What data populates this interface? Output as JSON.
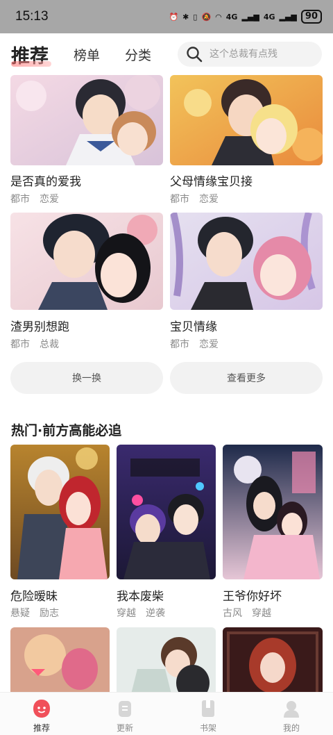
{
  "status": {
    "time": "15:13",
    "signal1": "4G",
    "signal2": "4G",
    "battery": "90"
  },
  "nav": {
    "tabs": [
      {
        "label": "推荐",
        "active": true
      },
      {
        "label": "榜单",
        "active": false
      },
      {
        "label": "分类",
        "active": false
      }
    ],
    "search_placeholder": "这个总裁有点残"
  },
  "grid": [
    {
      "title": "是否真的爱我",
      "tags": [
        "都市",
        "恋爱"
      ]
    },
    {
      "title": "父母情缘宝贝接",
      "tags": [
        "都市",
        "恋爱"
      ]
    },
    {
      "title": "渣男别想跑",
      "tags": [
        "都市",
        "总裁"
      ]
    },
    {
      "title": "宝贝情缘",
      "tags": [
        "都市",
        "恋爱"
      ]
    }
  ],
  "buttons": {
    "refresh": "换一换",
    "more": "查看更多"
  },
  "hot": {
    "title": "热门·前方高能必追",
    "items": [
      {
        "title": "危险暧昧",
        "tags": [
          "悬疑",
          "励志"
        ]
      },
      {
        "title": "我本废柴",
        "tags": [
          "穿越",
          "逆袭"
        ]
      },
      {
        "title": "王爷你好坏",
        "tags": [
          "古风",
          "穿越"
        ]
      }
    ]
  },
  "bottom_nav": [
    {
      "label": "推荐",
      "icon": "recommend-icon",
      "active": true
    },
    {
      "label": "更新",
      "icon": "update-icon",
      "active": false
    },
    {
      "label": "书架",
      "icon": "bookshelf-icon",
      "active": false
    },
    {
      "label": "我的",
      "icon": "profile-icon",
      "active": false
    }
  ],
  "colors": {
    "accent": "#f0505a",
    "status_bar": "#a7a7a7"
  }
}
